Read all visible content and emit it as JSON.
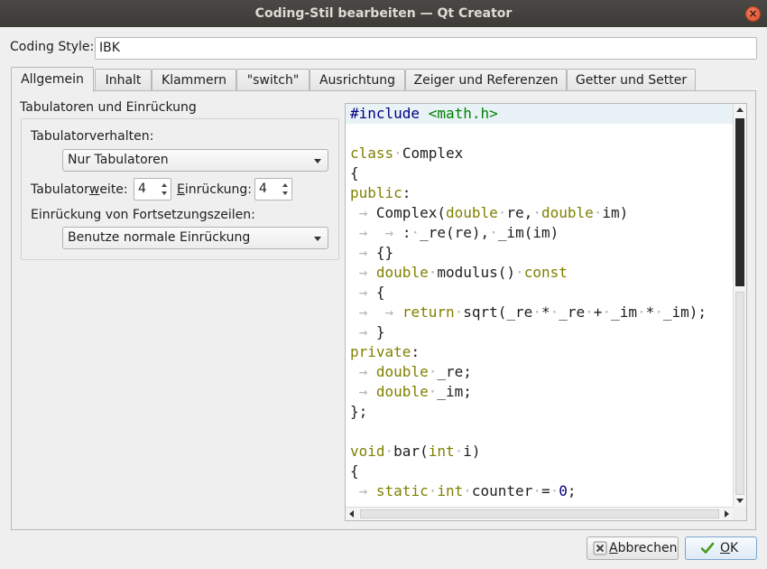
{
  "window": {
    "title": "Coding-Stil bearbeiten — Qt Creator",
    "close_glyph": "×"
  },
  "coding_style": {
    "label": "Coding Style:",
    "value": "IBK"
  },
  "tabs": [
    {
      "label": "Allgemein",
      "active": true
    },
    {
      "label": "Inhalt"
    },
    {
      "label": "Klammern"
    },
    {
      "label": "\"switch\""
    },
    {
      "label": "Ausrichtung"
    },
    {
      "label": "Zeiger und Referenzen"
    },
    {
      "label": "Getter und Setter"
    }
  ],
  "settings": {
    "group_title": "Tabulatoren und Einrückung",
    "tab_policy_label": "Tabulatorverhalten:",
    "tab_policy_value": "Nur Tabulatoren",
    "tab_width_label_pre": "Tabulator",
    "tab_width_label_u": "w",
    "tab_width_label_post": "eite:",
    "tab_width_value": "4",
    "indent_label_u": "E",
    "indent_label_post": "inrückung:",
    "indent_value": "4",
    "continuation_label": "Einrückung von Fortsetzungszeilen:",
    "continuation_value": "Benutze normale Einrückung"
  },
  "code_preview": {
    "lines": [
      "#include <math.h>",
      "",
      "class Complex",
      "{",
      "public:",
      "    Complex(double re, double im)",
      "        : _re(re), _im(im)",
      "    {}",
      "    double modulus() const",
      "    {",
      "        return sqrt(_re * _re + _im * _im);",
      "    }",
      "private:",
      "    double _re;",
      "    double _im;",
      "};",
      "",
      "void bar(int i)",
      "{",
      "    static int counter = 0;"
    ]
  },
  "buttons": {
    "cancel_pre": "",
    "cancel_u": "A",
    "cancel_post": "bbrechen",
    "ok_u": "O",
    "ok_post": "K"
  },
  "colors": {
    "keyword": "#808000",
    "preprocessor": "#000080",
    "include_path": "#008000",
    "whitespace_marker": "#b5b5b5",
    "current_line": "#e8f2f7"
  }
}
